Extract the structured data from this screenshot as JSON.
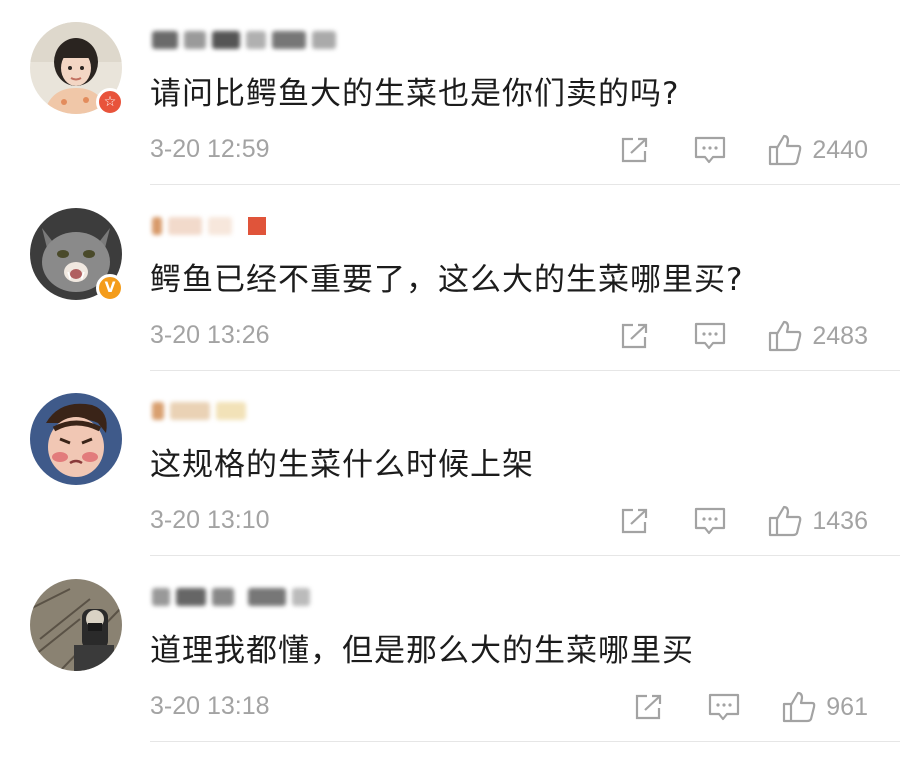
{
  "comments": [
    {
      "username": "",
      "text": "请问比鳄鱼大的生菜也是你们卖的吗?",
      "time": "3-20 12:59",
      "likes": "2440",
      "avatar": "woman-portrait",
      "badge": "☆",
      "badge_color": "#e8533b"
    },
    {
      "username": "",
      "text": "鳄鱼已经不重要了，这么大的生菜哪里买?",
      "time": "3-20 13:26",
      "likes": "2483",
      "avatar": "cat-photo",
      "badge": "V",
      "badge_color": "#f49c1a"
    },
    {
      "username": "",
      "text": "这规格的生菜什么时候上架",
      "time": "3-20 13:10",
      "likes": "1436",
      "avatar": "cartoon-face",
      "badge": "",
      "badge_color": ""
    },
    {
      "username": "",
      "text": "道理我都懂，但是那么大的生菜哪里买",
      "time": "3-20 13:18",
      "likes": "961",
      "avatar": "outdoor-photo",
      "badge": "",
      "badge_color": ""
    }
  ],
  "icons": {
    "share": "share-icon",
    "reply": "comment-icon",
    "like": "thumbs-up-icon"
  },
  "colors": {
    "text": "#1c1c1c",
    "meta": "#a3a3a3",
    "divider": "#e6e6e6"
  }
}
